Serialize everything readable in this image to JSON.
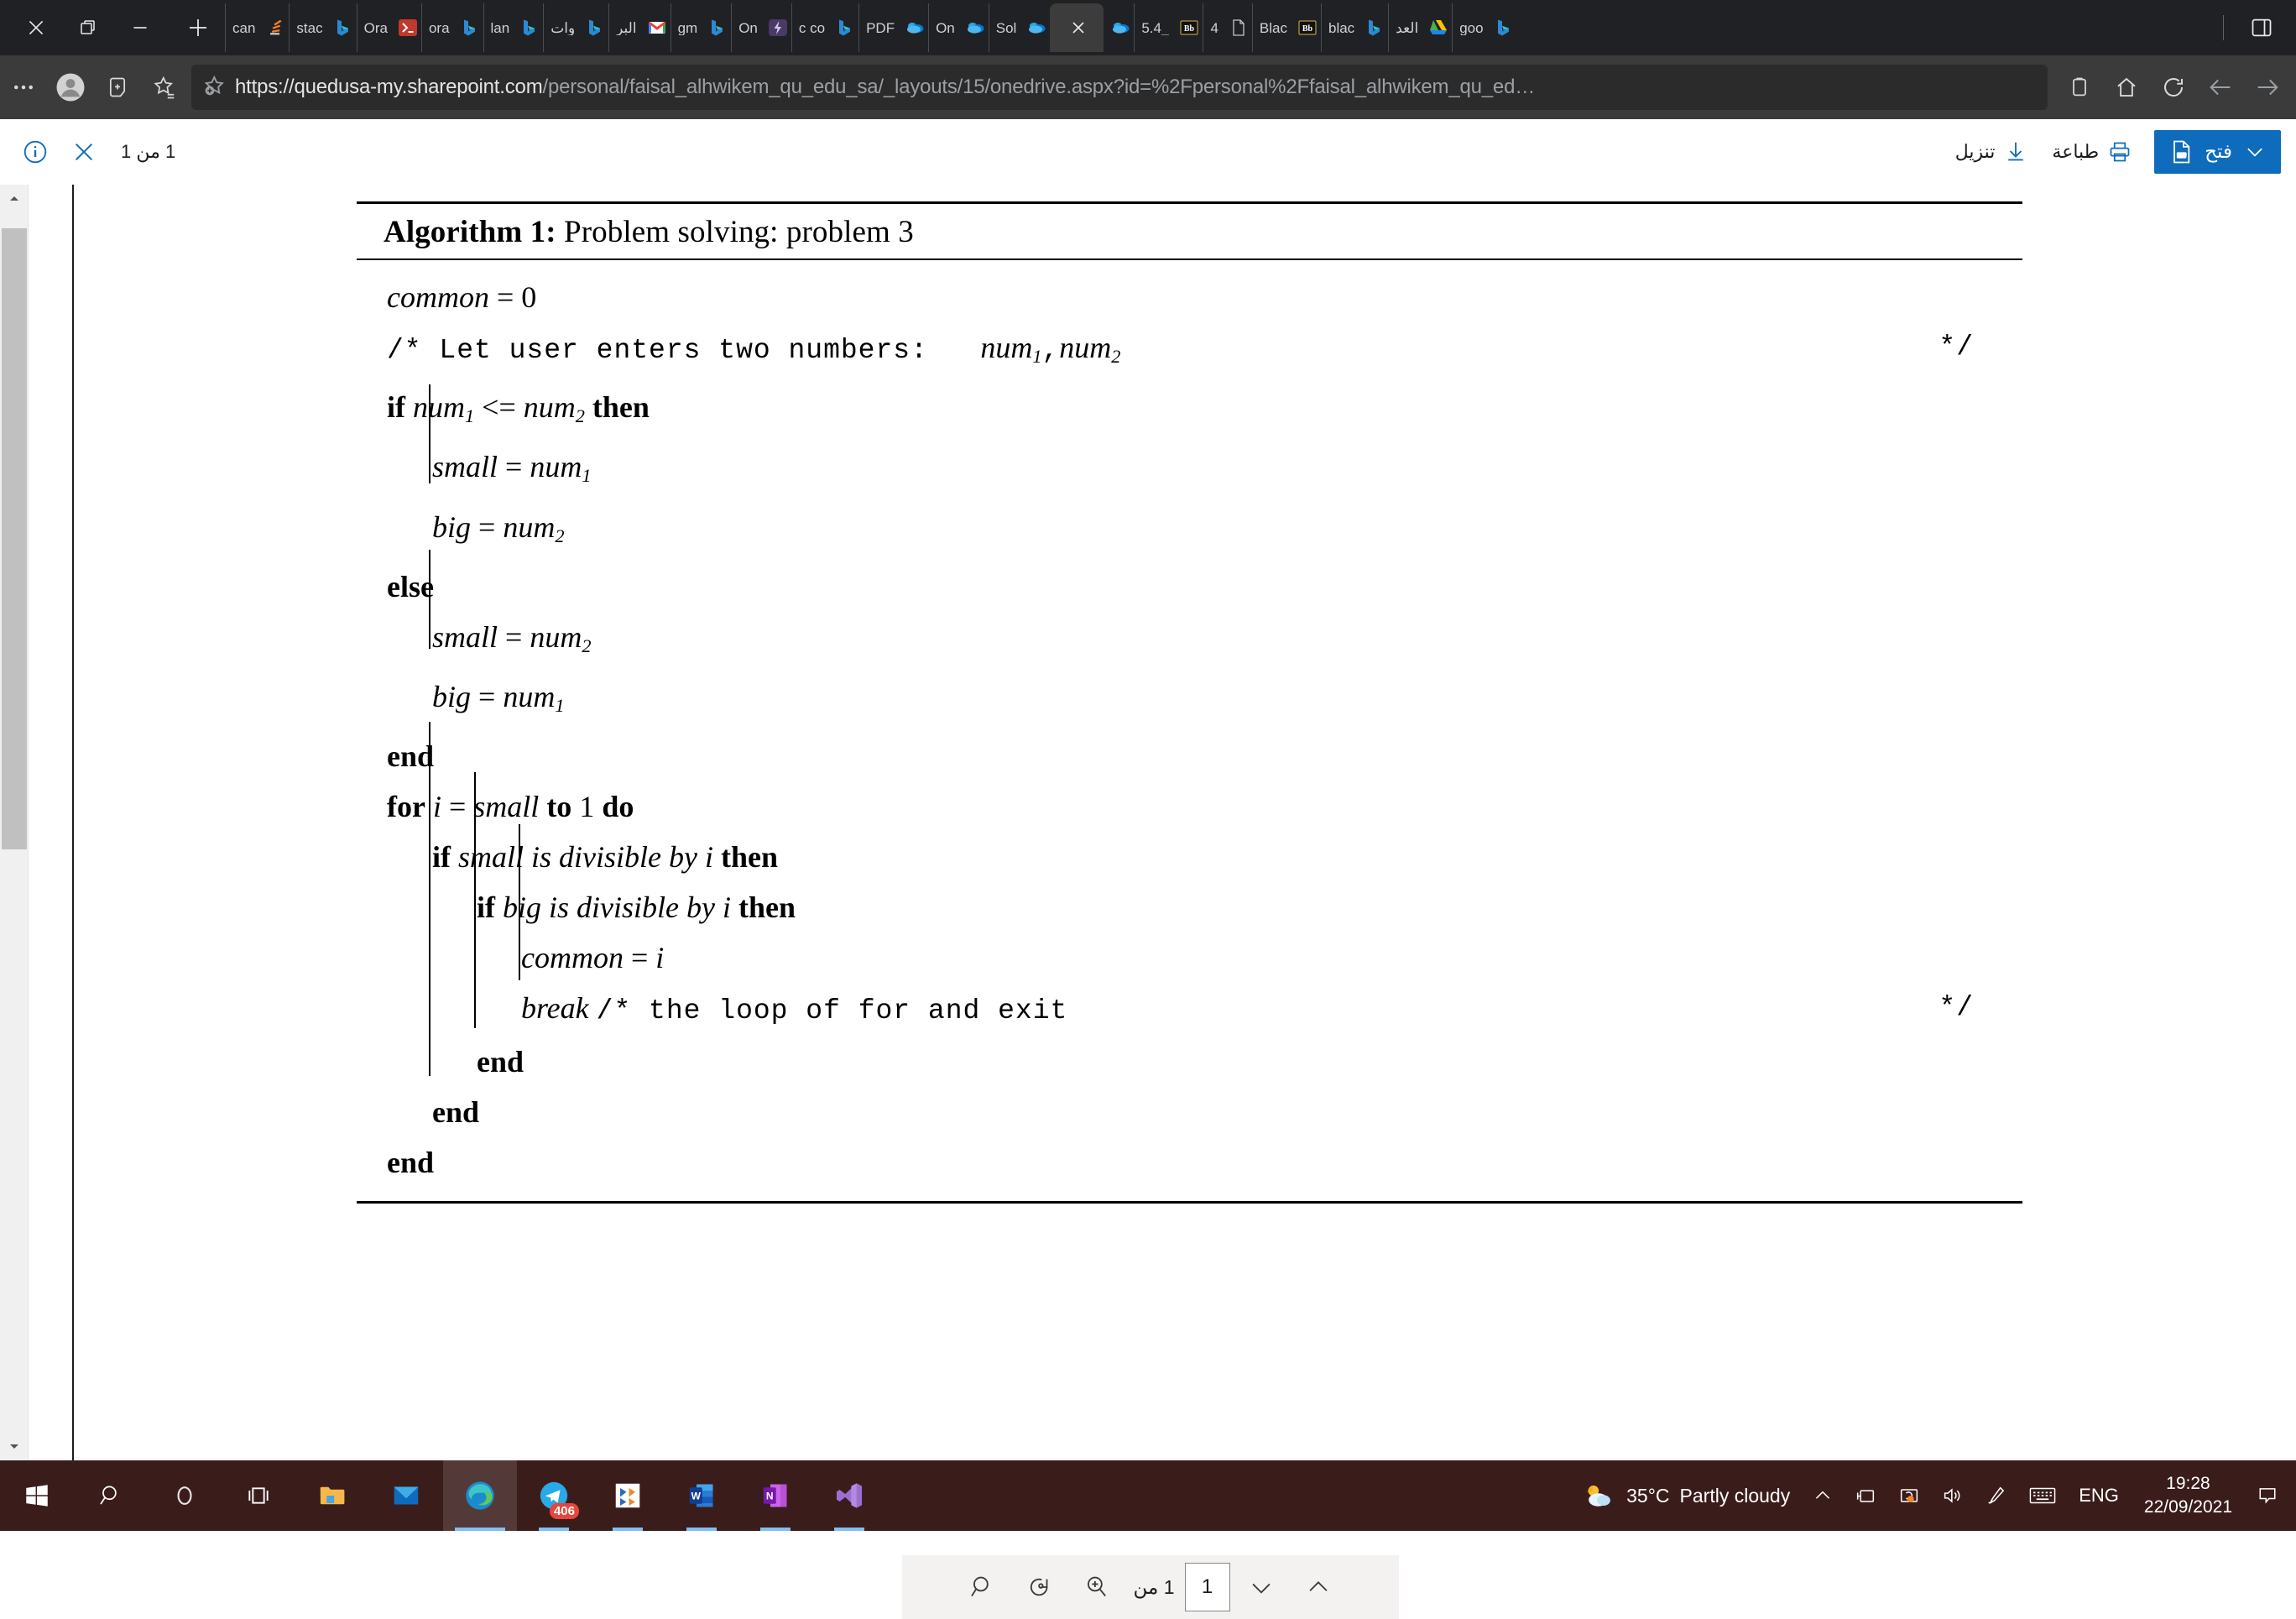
{
  "browser": {
    "window_controls": [
      {
        "name": "close-window",
        "glyph": "✕"
      },
      {
        "name": "restore-window",
        "glyph": "❐"
      },
      {
        "name": "minimize-window",
        "glyph": "—"
      }
    ],
    "new_tab_label": "+",
    "tabs": [
      {
        "title": "can",
        "icon": "text"
      },
      {
        "title": "",
        "icon": "stackoverflow"
      },
      {
        "title": "stac",
        "icon": "text"
      },
      {
        "title": "",
        "icon": "bing"
      },
      {
        "title": "Ora",
        "icon": "text"
      },
      {
        "title": "",
        "icon": "terminal"
      },
      {
        "title": "ora",
        "icon": "text"
      },
      {
        "title": "",
        "icon": "bing"
      },
      {
        "title": "lan",
        "icon": "text"
      },
      {
        "title": "",
        "icon": "bing"
      },
      {
        "title": "وات",
        "icon": "text"
      },
      {
        "title": "",
        "icon": "bing"
      },
      {
        "title": "البر",
        "icon": "text"
      },
      {
        "title": "",
        "icon": "gmail"
      },
      {
        "title": "gm",
        "icon": "text"
      },
      {
        "title": "",
        "icon": "bing"
      },
      {
        "title": "On",
        "icon": "text"
      },
      {
        "title": "",
        "icon": "power"
      },
      {
        "title": "c co",
        "icon": "text"
      },
      {
        "title": "",
        "icon": "bing"
      },
      {
        "title": "PDF",
        "icon": "text"
      },
      {
        "title": "",
        "icon": "onedrive"
      },
      {
        "title": "On",
        "icon": "text"
      },
      {
        "title": "",
        "icon": "onedrive"
      },
      {
        "title": "Sol",
        "icon": "text"
      },
      {
        "title": "",
        "icon": "onedrive"
      },
      {
        "title": "",
        "icon": "active-close"
      },
      {
        "title": "",
        "icon": "onedrive"
      },
      {
        "title": "5.4_",
        "icon": "text"
      },
      {
        "title": "",
        "icon": "blackboard"
      },
      {
        "title": "4",
        "icon": "text"
      },
      {
        "title": "",
        "icon": "page"
      },
      {
        "title": "Blac",
        "icon": "text"
      },
      {
        "title": "",
        "icon": "blackboard"
      },
      {
        "title": "blac",
        "icon": "text"
      },
      {
        "title": "",
        "icon": "bing"
      },
      {
        "title": "العد",
        "icon": "text"
      },
      {
        "title": "",
        "icon": "drive"
      },
      {
        "title": "goo",
        "icon": "text"
      },
      {
        "title": "",
        "icon": "bing"
      }
    ],
    "tab_list_button": "tab-list",
    "toolbar": {
      "settings_label": "…",
      "profile_label": "profile",
      "collections_label": "collections",
      "favorites_label": "favorites",
      "url_protocol": "https://",
      "url_host": "quedusa-my.sharepoint.com",
      "url_path": "/personal/faisal_alhwikem_qu_edu_sa/_layouts/15/onedrive.aspx?id=%2Fpersonal%2Ffaisal_alhwikem_qu_ed…",
      "url_full": "https://quedusa-my.sharepoint.com/personal/faisal_alhwikem_qu_edu_sa/_layouts/15/onedrive.aspx?id=%2Fpersonal%2Ffaisal_alhwikem_qu_ed…"
    }
  },
  "pdf_viewer": {
    "info_label": "معلومات",
    "close_label": "إغلاق",
    "page_count": "1 من 1",
    "download_label": "تنزيل",
    "print_label": "طباعة",
    "open_label": "فتح"
  },
  "algorithm": {
    "title_prefix": "Algorithm 1:",
    "title_text": " Problem solving: problem 3",
    "lines": [
      {
        "id": "l1",
        "text": "common = 0"
      },
      {
        "id": "l2",
        "text": "/* Let user enters two numbers:"
      },
      {
        "id": "l2b",
        "text": "num1, num2"
      },
      {
        "id": "l2c",
        "text": "*/"
      },
      {
        "id": "l3",
        "kw1": "if",
        "cond": "num1 <= num2",
        "kw2": "then"
      },
      {
        "id": "l4",
        "text": "small = num1"
      },
      {
        "id": "l5",
        "text": "big = num2"
      },
      {
        "id": "l6",
        "text": "else"
      },
      {
        "id": "l7",
        "text": "small = num2"
      },
      {
        "id": "l8",
        "text": "big = num1"
      },
      {
        "id": "l9",
        "text": "end"
      },
      {
        "id": "l10",
        "kw1": "for",
        "cond": "i = small",
        "kw2": "to 1 do"
      },
      {
        "id": "l11",
        "kw1": "if",
        "cond": "small is divisible by i",
        "kw2": "then"
      },
      {
        "id": "l12",
        "kw1": "if",
        "cond": "big is divisible by i",
        "kw2": "then"
      },
      {
        "id": "l13",
        "text": "common = i"
      },
      {
        "id": "l14",
        "text": "break /* the loop of for and exit",
        "close": "*/"
      },
      {
        "id": "l15",
        "text": "end"
      },
      {
        "id": "l16",
        "text": "end"
      },
      {
        "id": "l17",
        "text": "end"
      }
    ]
  },
  "page_toolbar": {
    "search_label": "بحث",
    "rotate_label": "تدوير",
    "zoom_label": "تكبير",
    "of_label": "1 من",
    "current_page": "1",
    "next_page_label": "الصفحة التالية",
    "prev_page_label": "الصفحة السابقة"
  },
  "taskbar": {
    "items": [
      {
        "name": "start-button",
        "icon": "windows"
      },
      {
        "name": "search-button",
        "icon": "search"
      },
      {
        "name": "cortana-button",
        "icon": "cortana"
      },
      {
        "name": "task-view-button",
        "icon": "taskview"
      },
      {
        "name": "file-explorer",
        "icon": "folder"
      },
      {
        "name": "mail-app",
        "icon": "mail"
      },
      {
        "name": "edge-browser",
        "icon": "edge",
        "state": "active"
      },
      {
        "name": "telegram-app",
        "icon": "telegram",
        "badge": "406",
        "state": "running"
      },
      {
        "name": "visio-app",
        "icon": "visio",
        "state": "running"
      },
      {
        "name": "word-app",
        "icon": "word",
        "state": "running"
      },
      {
        "name": "onenote-app",
        "icon": "onenote",
        "state": "running"
      },
      {
        "name": "visual-studio-app",
        "icon": "vs",
        "state": "running"
      }
    ],
    "tray": {
      "weather_temp": "35°C",
      "weather_desc": "Partly cloudy",
      "language": "ENG",
      "time": "19:28",
      "date": "22/09/2021"
    }
  }
}
